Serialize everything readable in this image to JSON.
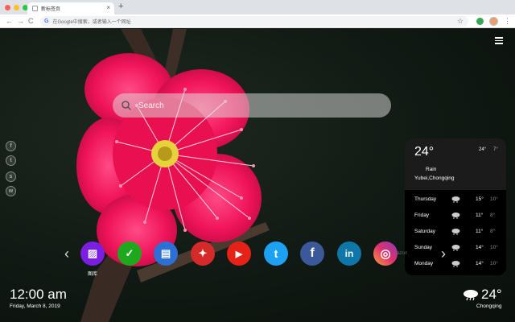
{
  "browser": {
    "tab_title": "新标签页",
    "tab_close": "×",
    "new_tab": "+",
    "omnibox_text": "在Google中搜索，或者输入一个网址",
    "back": "←",
    "forward": "→",
    "reload": "C",
    "bookmark": "☆",
    "menu": "⋮",
    "traffic_colors": [
      "#ff5f57",
      "#ffbd2e",
      "#28c940"
    ]
  },
  "search": {
    "placeholder": "Search"
  },
  "social": [
    {
      "icon": "facebook-icon",
      "glyph": "f"
    },
    {
      "icon": "twitter-icon",
      "glyph": "t"
    },
    {
      "icon": "snapchat-icon",
      "glyph": "s"
    },
    {
      "icon": "wechat-icon",
      "glyph": "w"
    }
  ],
  "weather_card": {
    "temp": "24°",
    "high": "24°",
    "low": "7°",
    "condition": "Rain",
    "location": "Yubei,Chongqing",
    "forecast": [
      {
        "day": "Thursday",
        "high": "15°",
        "low": "10°"
      },
      {
        "day": "Friday",
        "high": "11°",
        "low": "8°"
      },
      {
        "day": "Saturday",
        "high": "11°",
        "low": "8°"
      },
      {
        "day": "Sunday",
        "high": "14°",
        "low": "10°"
      },
      {
        "day": "Monday",
        "high": "14°",
        "low": "10°"
      }
    ]
  },
  "shortcuts": {
    "prev": "‹",
    "next": "›",
    "items": [
      {
        "name": "gallery",
        "label": "图库",
        "color": "#7a1ee0",
        "glyph": "▨"
      },
      {
        "name": "check",
        "label": "",
        "color": "#1ea81e",
        "glyph": "✓"
      },
      {
        "name": "notes",
        "label": "",
        "color": "#2c6fd6",
        "glyph": "▤"
      },
      {
        "name": "game",
        "label": "",
        "color": "#d42a2a",
        "glyph": "✦"
      },
      {
        "name": "youtube",
        "label": "",
        "color": "#e62117",
        "glyph": "▶"
      },
      {
        "name": "twitter",
        "label": "",
        "color": "#1da1f2",
        "glyph": "t"
      },
      {
        "name": "facebook",
        "label": "",
        "color": "#3b5998",
        "glyph": "f"
      },
      {
        "name": "linkedin",
        "label": "",
        "color": "#0e76a8",
        "glyph": "in"
      },
      {
        "name": "instagram",
        "label": "",
        "color": "#c13584",
        "glyph": "◎"
      }
    ],
    "faint_label": "amazon"
  },
  "clock": {
    "time": "12:00 am",
    "date": "Friday, March 8, 2019"
  },
  "bottom_weather": {
    "temp": "24°",
    "city": "Chongqing"
  }
}
